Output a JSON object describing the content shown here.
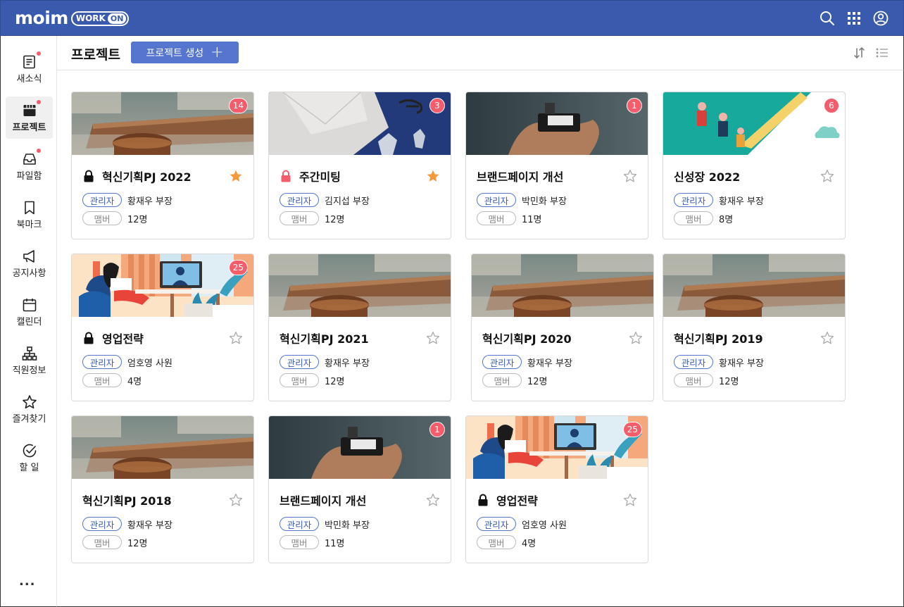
{
  "brand": {
    "name": "moim",
    "work": "WORK",
    "on": "ON"
  },
  "sidebar": {
    "items": [
      {
        "label": "새소식",
        "icon": "news-icon",
        "dot": true,
        "active": false
      },
      {
        "label": "프로젝트",
        "icon": "project-icon",
        "dot": true,
        "active": true
      },
      {
        "label": "파일함",
        "icon": "inbox-icon",
        "dot": true,
        "active": false
      },
      {
        "label": "북마크",
        "icon": "bookmark-icon",
        "dot": false,
        "active": false
      },
      {
        "label": "공지사항",
        "icon": "megaphone-icon",
        "dot": false,
        "active": false
      },
      {
        "label": "캘린더",
        "icon": "calendar-icon",
        "dot": false,
        "active": false
      },
      {
        "label": "직원정보",
        "icon": "org-chart-icon",
        "dot": false,
        "active": false
      },
      {
        "label": "즐겨찾기",
        "icon": "star-icon",
        "dot": false,
        "active": false
      },
      {
        "label": "할 일",
        "icon": "check-circle-icon",
        "dot": false,
        "active": false
      }
    ],
    "more": "..."
  },
  "header": {
    "title": "프로젝트",
    "create_label": "프로젝트 생성"
  },
  "labels": {
    "admin": "관리자",
    "member": "맴버"
  },
  "colors": {
    "topbar": "#3a5aad",
    "accent": "#5575cf",
    "badge": "#f35d6c",
    "star_on": "#f59a3c"
  },
  "cards": [
    {
      "title": "혁신기획PJ 2022",
      "admin": "황재우 부장",
      "members": "12명",
      "badge": "14",
      "locked": true,
      "lock_color": "#111111",
      "starred": true,
      "thumb": "cafe"
    },
    {
      "title": "주간미팅",
      "admin": "김지섭 부장",
      "members": "12명",
      "badge": "3",
      "locked": true,
      "lock_color": "#f35d6c",
      "starred": true,
      "thumb": "desk"
    },
    {
      "title": "브랜드페이지 개선",
      "admin": "박민화 부장",
      "members": "11명",
      "badge": "1",
      "locked": false,
      "starred": false,
      "thumb": "film"
    },
    {
      "title": "신성장 2022",
      "admin": "황재우 부장",
      "members": "8명",
      "badge": "6",
      "locked": false,
      "starred": false,
      "thumb": "teal"
    },
    {
      "title": "영업전략",
      "admin": "엄호영 사원",
      "members": "4명",
      "badge": "25",
      "locked": true,
      "lock_color": "#111111",
      "starred": false,
      "thumb": "video"
    },
    {
      "title": "혁신기획PJ 2021",
      "admin": "황재우 부장",
      "members": "12명",
      "badge": "",
      "locked": false,
      "starred": false,
      "thumb": "cafe"
    },
    {
      "title": "혁신기획PJ 2020",
      "admin": "황재우 부장",
      "members": "12명",
      "badge": "",
      "locked": false,
      "starred": false,
      "thumb": "cafe"
    },
    {
      "title": "혁신기획PJ 2019",
      "admin": "황재우 부장",
      "members": "12명",
      "badge": "",
      "locked": false,
      "starred": false,
      "thumb": "cafe"
    },
    {
      "title": "혁신기획PJ 2018",
      "admin": "황재우 부장",
      "members": "12명",
      "badge": "",
      "locked": false,
      "starred": false,
      "thumb": "cafe"
    },
    {
      "title": "브랜드페이지 개선",
      "admin": "박민화 부장",
      "members": "11명",
      "badge": "1",
      "locked": false,
      "starred": false,
      "thumb": "film"
    },
    {
      "title": "영업전략",
      "admin": "엄호영 사원",
      "members": "4명",
      "badge": "25",
      "locked": true,
      "lock_color": "#111111",
      "starred": false,
      "thumb": "video"
    }
  ]
}
